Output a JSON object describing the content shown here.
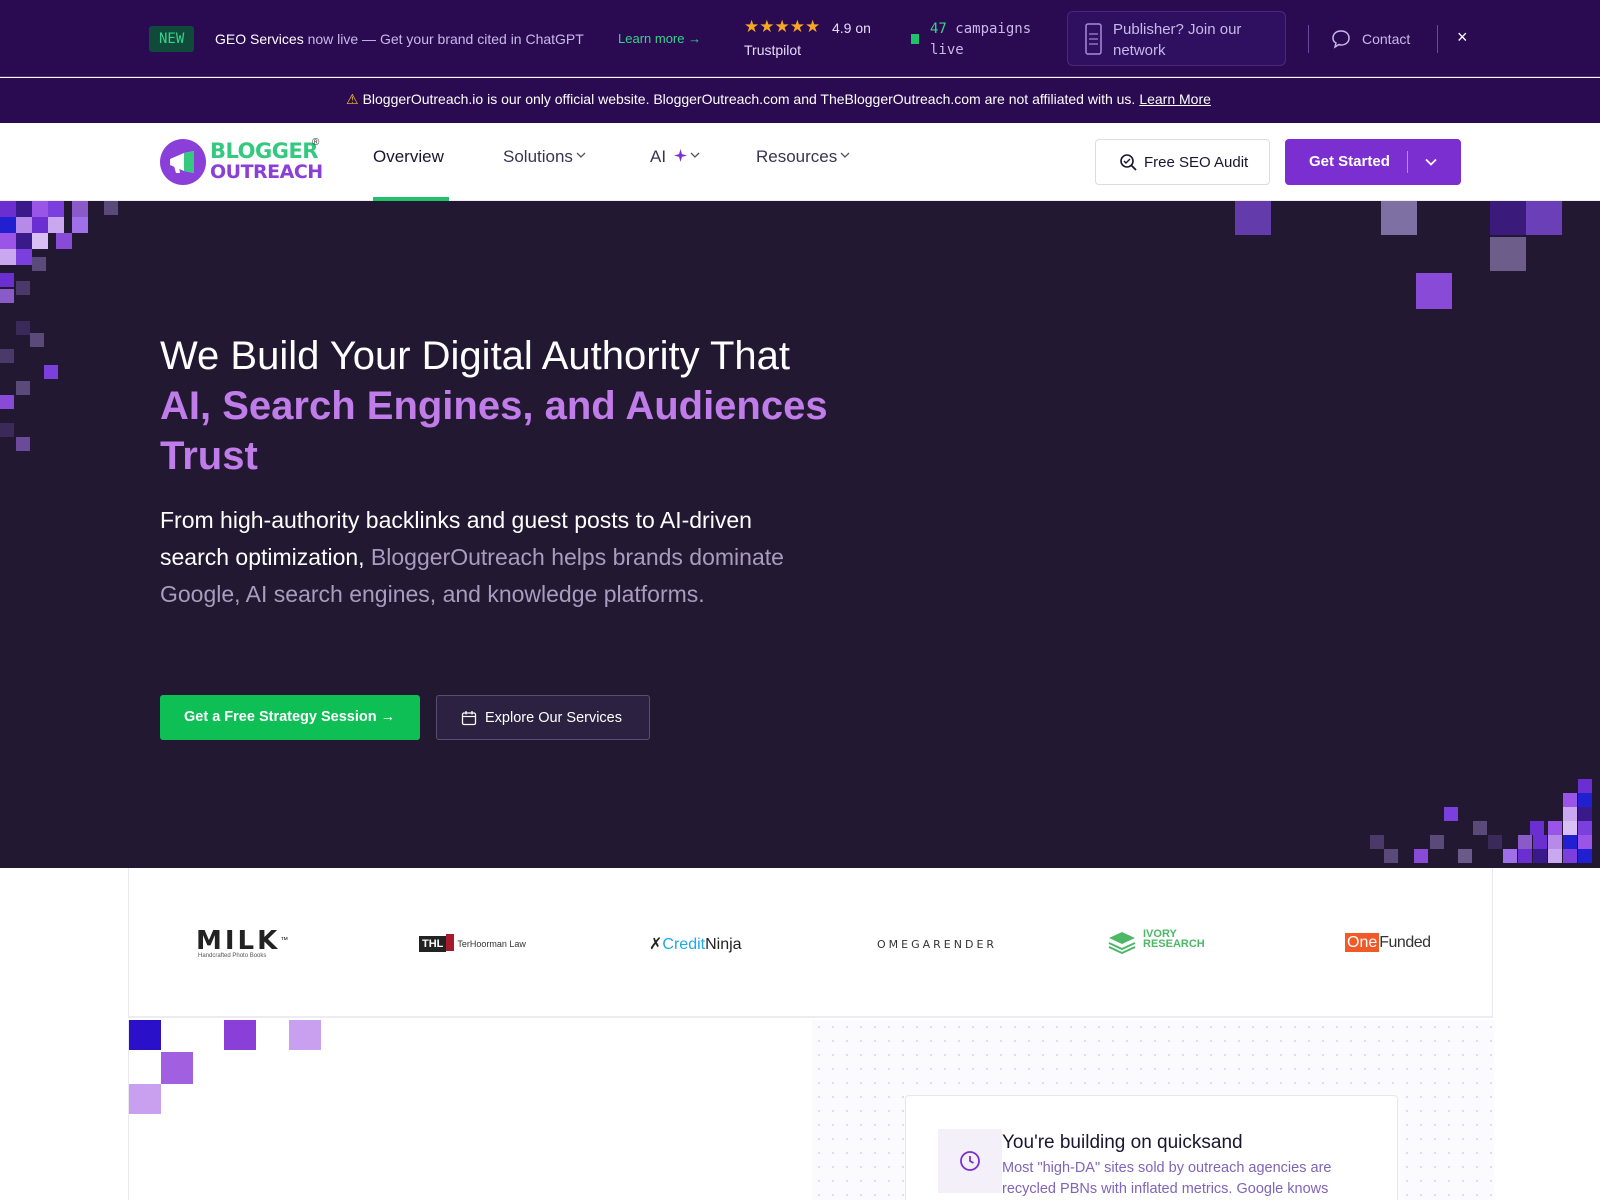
{
  "topbar": {
    "new_badge": "NEW",
    "geo_strong": "GEO Services",
    "geo_rest": " now live — Get your brand cited in ChatGPT",
    "learn_more": "Learn more →",
    "stars": "★★★★★",
    "rating": "4.9 on",
    "rating_source": "Trustpilot",
    "campaigns_count": "47",
    "campaigns_label": " campaigns live",
    "publisher": "Publisher? Join our network",
    "contact": "Contact",
    "close": "×"
  },
  "warning": {
    "text": "BloggerOutreach.io is our only official website. BloggerOutreach.com and TheBloggerOutreach.com are not affiliated with us.",
    "link": "Learn More"
  },
  "nav": {
    "logo_top": "BLOGGER",
    "logo_reg": "®",
    "logo_bottom": "OUTREACH",
    "items": [
      {
        "label": "Overview"
      },
      {
        "label": "Solutions"
      },
      {
        "label": "AI"
      },
      {
        "label": "Resources"
      }
    ],
    "seo_audit": "Free SEO Audit",
    "get_started": "Get Started"
  },
  "hero": {
    "title_line1": "We Build Your Digital Authority That",
    "title_accent": "AI, Search Engines, and Audiences Trust",
    "sub_highlight": "From high-authority backlinks and guest posts to AI-driven search optimization,",
    "sub_rest": " BloggerOutreach helps brands dominate Google, AI search engines, and knowledge platforms.",
    "cta_primary": "Get a Free Strategy Session →",
    "cta_secondary": "Explore Our Services"
  },
  "logos": {
    "milk": "MILK",
    "milk_tm": "™",
    "milk_sub": "Handcrafted Photo Books",
    "thl_box": "THL",
    "thl_text": "TerHoorman Law",
    "cn_credit": "Credit",
    "cn_ninja": "Ninja",
    "omegarender": "OMEGARENDER",
    "ivory_top": "IVORY",
    "ivory_bottom": "RESEARCH",
    "one": "One",
    "funded": "Funded"
  },
  "card": {
    "title": "You're building on quicksand",
    "desc": "Most \"high-DA\" sites sold by outreach agencies are recycled PBNs with inflated metrics. Google knows"
  },
  "colors": {
    "topbar_bg": "#2a0b52",
    "hero_bg": "#221832",
    "accent_purple": "#7b2fd1",
    "accent_green": "#0dbf55",
    "hero_accent_text": "#c07ce8"
  }
}
